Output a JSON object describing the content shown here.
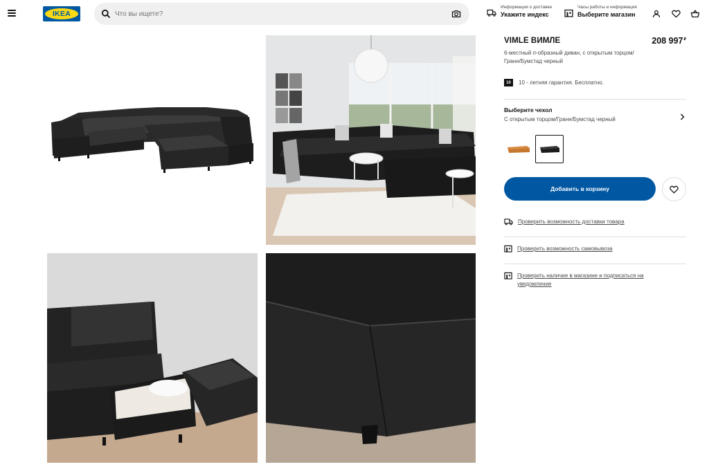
{
  "header": {
    "logo_text": "IKEA",
    "search_placeholder": "Что вы ищете?",
    "delivery_small": "Информация о доставке",
    "delivery_big": "Укажите индекс",
    "store_small": "Часы работы и информация",
    "store_big": "Выберите магазин"
  },
  "product": {
    "name": "VIMLE ВИМЛЕ",
    "price": "208 997",
    "currency": "₽",
    "description": "6-местный п-образный диван, с открытым торцом/Гранн/Бумстад черный",
    "warranty_badge": "10",
    "warranty_text": "10 - летняя гарантия. Бесплатно.",
    "cover_title": "Выберите чехол",
    "cover_value": "С открытым торцом/Гранн/Бумстад черный",
    "add_to_cart": "Добавить в корзину",
    "links": [
      "Проверить возможность доставки товара",
      "Проверить возможность самовывоза",
      "Проверить наличие в магазине и подписаться на уведомление"
    ]
  },
  "colors": {
    "ikea_blue": "#0058a3",
    "ikea_yellow": "#fbd914",
    "sofa_black": "#1c1c1c",
    "swatch_brown": "#c7782f"
  }
}
